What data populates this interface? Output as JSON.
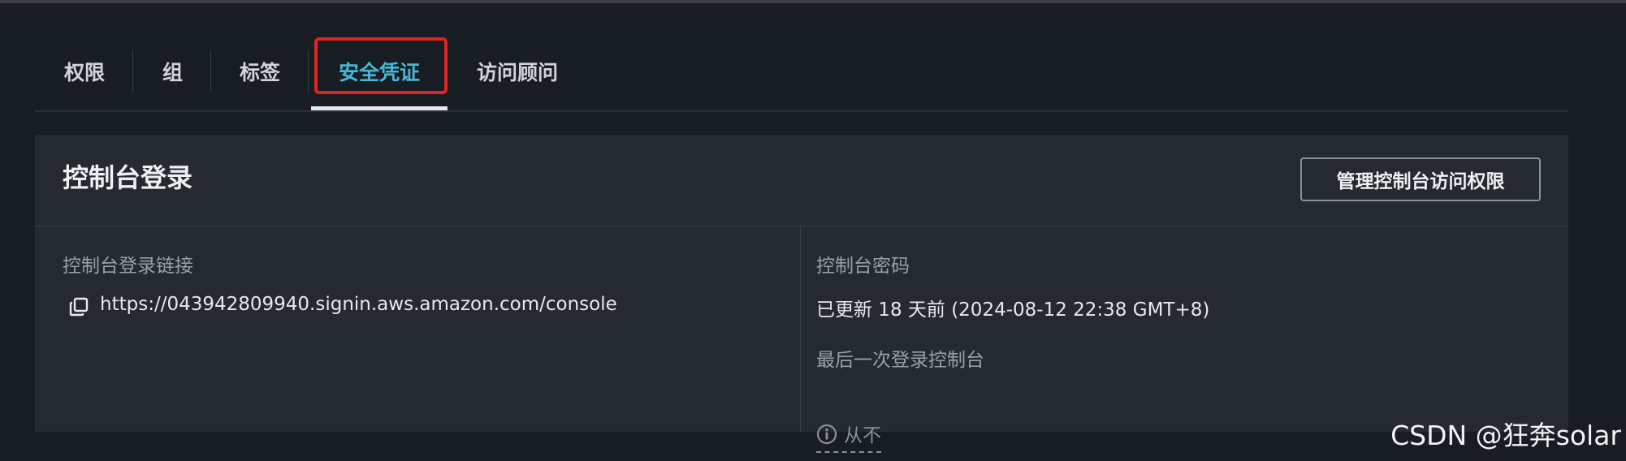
{
  "tabs": [
    {
      "label": "权限"
    },
    {
      "label": "组"
    },
    {
      "label": "标签"
    },
    {
      "label": "安全凭证",
      "active": true
    },
    {
      "label": "访问顾问"
    }
  ],
  "panel": {
    "title": "控制台登录",
    "manage_button": "管理控制台访问权限",
    "left": {
      "link_label": "控制台登录链接",
      "link_value": "https://043942809940.signin.aws.amazon.com/console",
      "copy_icon": "copy-icon"
    },
    "right": {
      "password_label": "控制台密码",
      "password_value": "已更新 18 天前 (2024-08-12 22:38 GMT+8)",
      "last_login_label": "最后一次登录控制台",
      "last_login_value": "从不",
      "info_icon": "info-icon"
    }
  },
  "watermark": "CSDN @狂奔solar",
  "colors": {
    "background": "#181c23",
    "panel": "#252930",
    "active_tab": "#44b9d6",
    "highlight_box": "#e32222"
  }
}
